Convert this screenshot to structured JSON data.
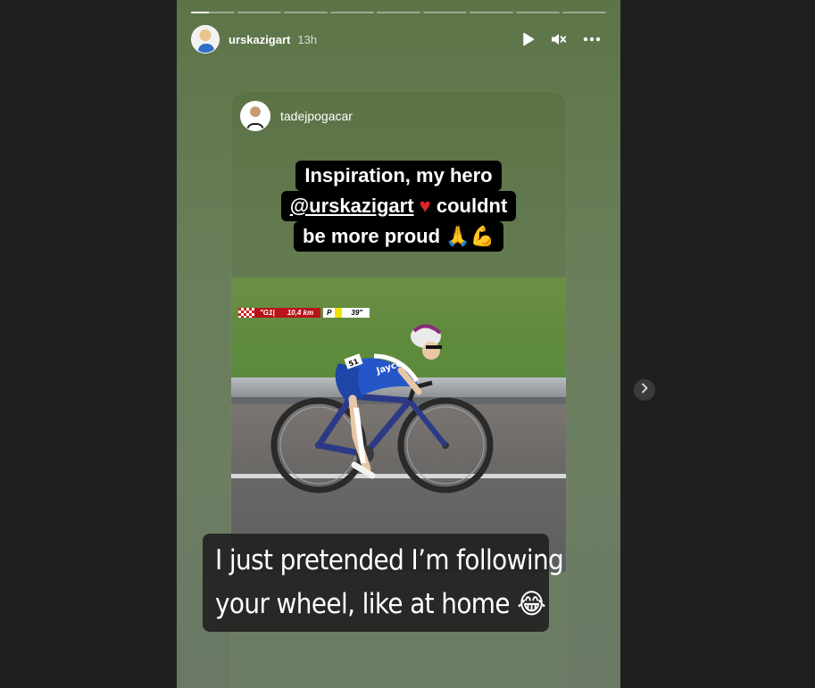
{
  "story": {
    "segments": 9,
    "active_segment": 0,
    "active_progress": 0.4,
    "author": "urskazigart",
    "time": "13h",
    "actions": {
      "play": "play-icon",
      "mute": "mute-icon",
      "more": "more-icon"
    }
  },
  "shared_post": {
    "author": "tadejpogacar",
    "caption": {
      "line1": "Inspiration, my hero",
      "line2_mention": "@urskazigart",
      "line2_emoji": "♥",
      "line2_rest": " couldnt",
      "line3_text": "be more proud ",
      "line3_emoji": "🙏💪"
    },
    "video_hud": {
      "stage": "\"G1|",
      "distance": "10,4 km",
      "position": "P",
      "gap": "39\""
    },
    "jersey_number": "51",
    "sponsor": "Jayco"
  },
  "overlay_comment": {
    "line1": "I just pretended I’m following",
    "line2": "your wheel, like at home 😂"
  },
  "navigation": {
    "next": "chevron-right-icon"
  }
}
